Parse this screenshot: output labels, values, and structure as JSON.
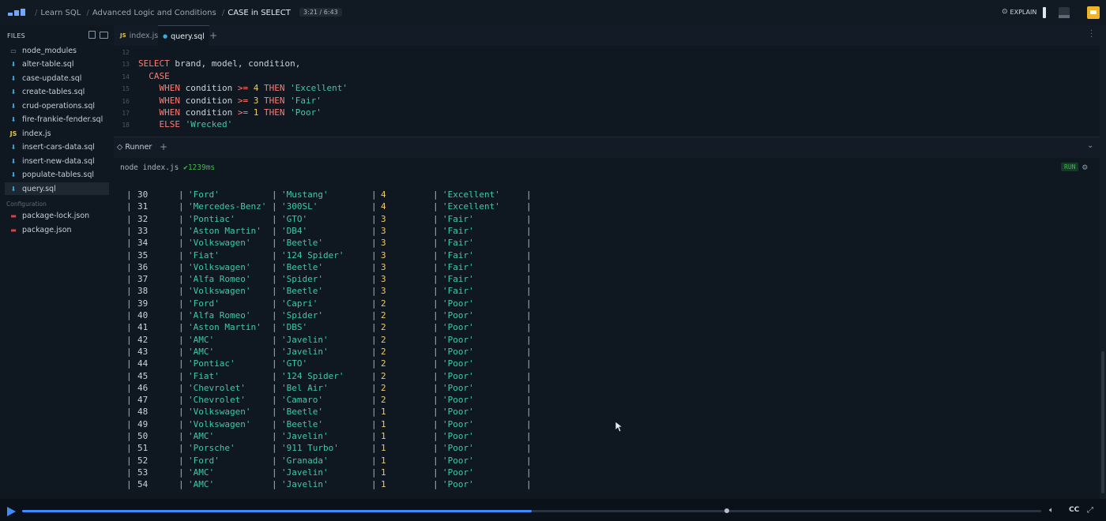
{
  "topbar": {
    "breadcrumbs": [
      "Learn SQL",
      "Advanced Logic and Conditions",
      "CASE in SELECT"
    ],
    "time": "3:21 / 6:43",
    "explain_label": "EXPLAIN"
  },
  "sidebar": {
    "title": "FILES",
    "items": [
      {
        "name": "node_modules",
        "type": "folder"
      },
      {
        "name": "alter-table.sql",
        "type": "sql"
      },
      {
        "name": "case-update.sql",
        "type": "sql"
      },
      {
        "name": "create-tables.sql",
        "type": "sql"
      },
      {
        "name": "crud-operations.sql",
        "type": "sql"
      },
      {
        "name": "fire-frankie-fender.sql",
        "type": "sql"
      },
      {
        "name": "index.js",
        "type": "js"
      },
      {
        "name": "insert-cars-data.sql",
        "type": "sql"
      },
      {
        "name": "insert-new-data.sql",
        "type": "sql"
      },
      {
        "name": "populate-tables.sql",
        "type": "sql"
      },
      {
        "name": "query.sql",
        "type": "sql",
        "active": true
      }
    ],
    "config_label": "Configuration",
    "config_items": [
      {
        "name": "package-lock.json",
        "type": "json"
      },
      {
        "name": "package.json",
        "type": "json"
      }
    ]
  },
  "editor": {
    "tabs": [
      {
        "label": "index.js",
        "icon": "JS"
      },
      {
        "label": "query.sql",
        "icon": "sql",
        "active": true
      }
    ],
    "lines": [
      {
        "n": "12",
        "tokens": []
      },
      {
        "n": "13",
        "tokens": [
          [
            "kw",
            "SELECT"
          ],
          [
            "id",
            " brand, model, condition,"
          ]
        ]
      },
      {
        "n": "14",
        "tokens": [
          [
            "kw",
            "  CASE"
          ]
        ]
      },
      {
        "n": "15",
        "tokens": [
          [
            "kw",
            "    WHEN"
          ],
          [
            "id",
            " condition "
          ],
          [
            "kw",
            ">="
          ],
          [
            "id",
            " "
          ],
          [
            "num",
            "4"
          ],
          [
            "id",
            " "
          ],
          [
            "kw",
            "THEN"
          ],
          [
            "id",
            " "
          ],
          [
            "str",
            "'Excellent'"
          ]
        ]
      },
      {
        "n": "16",
        "tokens": [
          [
            "kw",
            "    WHEN"
          ],
          [
            "id",
            " condition "
          ],
          [
            "kw",
            ">="
          ],
          [
            "id",
            " "
          ],
          [
            "num",
            "3"
          ],
          [
            "id",
            " "
          ],
          [
            "kw",
            "THEN"
          ],
          [
            "id",
            " "
          ],
          [
            "str",
            "'Fair'"
          ]
        ]
      },
      {
        "n": "17",
        "tokens": [
          [
            "kw",
            "    WHEN"
          ],
          [
            "id",
            " condition "
          ],
          [
            "kw",
            ">="
          ],
          [
            "id",
            " "
          ],
          [
            "num",
            "1"
          ],
          [
            "id",
            " "
          ],
          [
            "kw",
            "THEN"
          ],
          [
            "id",
            " "
          ],
          [
            "str",
            "'Poor'"
          ]
        ]
      },
      {
        "n": "18",
        "tokens": [
          [
            "kw",
            "    ELSE"
          ],
          [
            "id",
            " "
          ],
          [
            "str",
            "'Wrecked'"
          ]
        ]
      }
    ]
  },
  "runner": {
    "tab_label": "Runner",
    "command": "node index.js",
    "duration": "✔1239ms",
    "run_label": "RUN",
    "rows": [
      [
        "30",
        "'Ford'",
        "'Mustang'",
        "4",
        "'Excellent'"
      ],
      [
        "31",
        "'Mercedes-Benz'",
        "'300SL'",
        "4",
        "'Excellent'"
      ],
      [
        "32",
        "'Pontiac'",
        "'GTO'",
        "3",
        "'Fair'"
      ],
      [
        "33",
        "'Aston Martin'",
        "'DB4'",
        "3",
        "'Fair'"
      ],
      [
        "34",
        "'Volkswagen'",
        "'Beetle'",
        "3",
        "'Fair'"
      ],
      [
        "35",
        "'Fiat'",
        "'124 Spider'",
        "3",
        "'Fair'"
      ],
      [
        "36",
        "'Volkswagen'",
        "'Beetle'",
        "3",
        "'Fair'"
      ],
      [
        "37",
        "'Alfa Romeo'",
        "'Spider'",
        "3",
        "'Fair'"
      ],
      [
        "38",
        "'Volkswagen'",
        "'Beetle'",
        "3",
        "'Fair'"
      ],
      [
        "39",
        "'Ford'",
        "'Capri'",
        "2",
        "'Poor'"
      ],
      [
        "40",
        "'Alfa Romeo'",
        "'Spider'",
        "2",
        "'Poor'"
      ],
      [
        "41",
        "'Aston Martin'",
        "'DBS'",
        "2",
        "'Poor'"
      ],
      [
        "42",
        "'AMC'",
        "'Javelin'",
        "2",
        "'Poor'"
      ],
      [
        "43",
        "'AMC'",
        "'Javelin'",
        "2",
        "'Poor'"
      ],
      [
        "44",
        "'Pontiac'",
        "'GTO'",
        "2",
        "'Poor'"
      ],
      [
        "45",
        "'Fiat'",
        "'124 Spider'",
        "2",
        "'Poor'"
      ],
      [
        "46",
        "'Chevrolet'",
        "'Bel Air'",
        "2",
        "'Poor'"
      ],
      [
        "47",
        "'Chevrolet'",
        "'Camaro'",
        "2",
        "'Poor'"
      ],
      [
        "48",
        "'Volkswagen'",
        "'Beetle'",
        "1",
        "'Poor'"
      ],
      [
        "49",
        "'Volkswagen'",
        "'Beetle'",
        "1",
        "'Poor'"
      ],
      [
        "50",
        "'AMC'",
        "'Javelin'",
        "1",
        "'Poor'"
      ],
      [
        "51",
        "'Porsche'",
        "'911 Turbo'",
        "1",
        "'Poor'"
      ],
      [
        "52",
        "'Ford'",
        "'Granada'",
        "1",
        "'Poor'"
      ],
      [
        "53",
        "'AMC'",
        "'Javelin'",
        "1",
        "'Poor'"
      ],
      [
        "54",
        "'AMC'",
        "'Javelin'",
        "1",
        "'Poor'"
      ]
    ]
  },
  "video": {
    "progress": 0.5,
    "cc_label": "CC"
  },
  "colors": {
    "accent": "#3d8bfd",
    "keyword": "#ff7b72",
    "string": "#3ec9a7",
    "number": "#f2cc60",
    "success": "#3fb950"
  }
}
